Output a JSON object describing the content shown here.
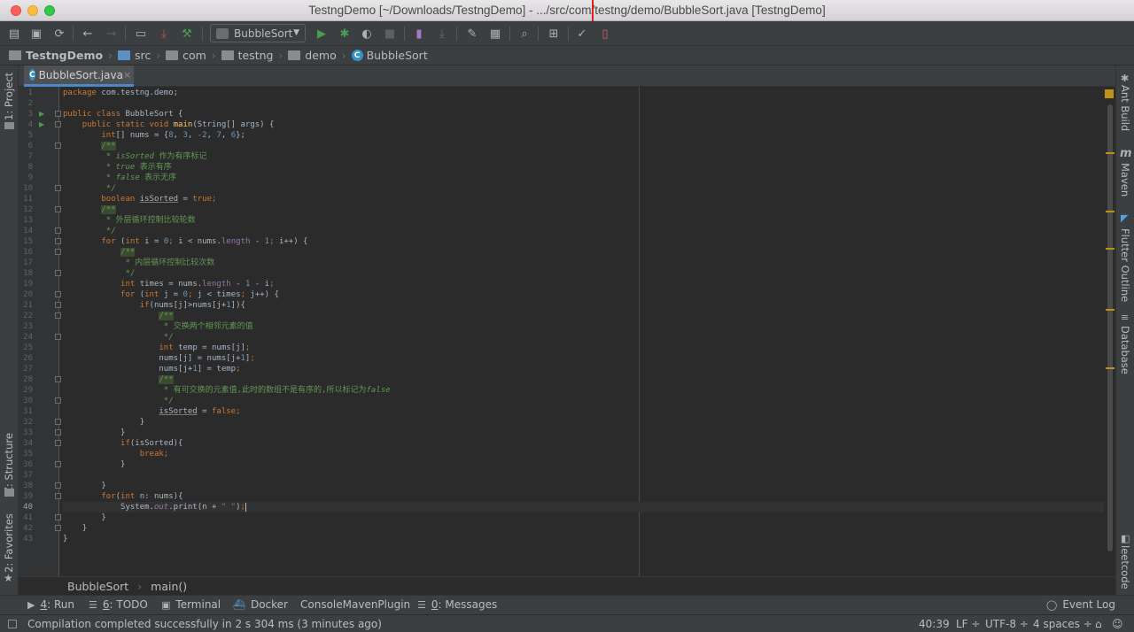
{
  "window": {
    "title": "TestngDemo [~/Downloads/TestngDemo] - .../src/com/testng/demo/BubbleSort.java [TestngDemo]"
  },
  "toolbar": {
    "run_config": "BubbleSort",
    "icons": [
      "open-icon",
      "save-icon",
      "sync-icon",
      "back-icon",
      "forward-icon",
      "terminal-icon",
      "download-icon",
      "build-icon",
      "run-icon",
      "debug-icon",
      "coverage-icon",
      "stop-icon",
      "app-icon",
      "deploy-icon",
      "wrench-icon",
      "structure-icon",
      "search-icon",
      "translate-icon",
      "vcs-icon",
      "device-icon"
    ]
  },
  "breadcrumb": {
    "project": "TestngDemo",
    "items": [
      "src",
      "com",
      "testng",
      "demo",
      "BubbleSort"
    ]
  },
  "editor": {
    "tab_label": "BubbleSort.java",
    "current_line": 40,
    "lines": [
      [
        [
          "kw",
          "package "
        ],
        [
          "",
          "com.testng.demo;"
        ]
      ],
      [],
      [
        [
          "kw",
          "public class "
        ],
        [
          "",
          "BubbleSort {"
        ]
      ],
      [
        [
          "",
          "    "
        ],
        [
          "kw",
          "public static void "
        ],
        [
          "fn",
          "main"
        ],
        [
          "",
          "(String[] args) {"
        ]
      ],
      [
        [
          "",
          "        "
        ],
        [
          "kw",
          "int"
        ],
        [
          "",
          "[] nums = {"
        ],
        [
          "num",
          "8"
        ],
        [
          "",
          ", "
        ],
        [
          "num",
          "3"
        ],
        [
          "",
          ", "
        ],
        [
          "num",
          "-2"
        ],
        [
          "",
          ", "
        ],
        [
          "num",
          "7"
        ],
        [
          "",
          ", "
        ],
        [
          "num",
          "6"
        ],
        [
          "",
          "};"
        ]
      ],
      [
        [
          "",
          "        "
        ],
        [
          "docb",
          "/**"
        ]
      ],
      [
        [
          "",
          "         "
        ],
        [
          "doc",
          "* "
        ],
        [
          "doci",
          "isSorted "
        ],
        [
          "doc",
          "作为有序标记"
        ]
      ],
      [
        [
          "",
          "         "
        ],
        [
          "doc",
          "* "
        ],
        [
          "doci",
          "true "
        ],
        [
          "doc",
          "表示有序"
        ]
      ],
      [
        [
          "",
          "         "
        ],
        [
          "doc",
          "* "
        ],
        [
          "doci",
          "false "
        ],
        [
          "doc",
          "表示无序"
        ]
      ],
      [
        [
          "",
          "         "
        ],
        [
          "doc",
          "*/"
        ]
      ],
      [
        [
          "",
          "        "
        ],
        [
          "kw",
          "boolean "
        ],
        [
          "ul",
          "isSorted"
        ],
        [
          "",
          " = "
        ],
        [
          "kw",
          "true"
        ],
        [
          "kw",
          ";"
        ]
      ],
      [
        [
          "",
          "        "
        ],
        [
          "docb",
          "/**"
        ]
      ],
      [
        [
          "",
          "         "
        ],
        [
          "doc",
          "* 外层循环控制比较轮数"
        ]
      ],
      [
        [
          "",
          "         "
        ],
        [
          "doc",
          "*/"
        ]
      ],
      [
        [
          "",
          "        "
        ],
        [
          "kw",
          "for "
        ],
        [
          "",
          "("
        ],
        [
          "kw",
          "int "
        ],
        [
          "",
          "i = "
        ],
        [
          "num",
          "0"
        ],
        [
          "kw",
          "; "
        ],
        [
          "",
          "i < nums."
        ],
        [
          "fld",
          "length "
        ],
        [
          "",
          "- "
        ],
        [
          "num",
          "1"
        ],
        [
          "kw",
          "; "
        ],
        [
          "",
          "i++) {"
        ]
      ],
      [
        [
          "",
          "            "
        ],
        [
          "docb",
          "/**"
        ]
      ],
      [
        [
          "",
          "             "
        ],
        [
          "doc",
          "* 内层循环控制比较次数"
        ]
      ],
      [
        [
          "",
          "             "
        ],
        [
          "doc",
          "*/"
        ]
      ],
      [
        [
          "",
          "            "
        ],
        [
          "kw",
          "int "
        ],
        [
          "",
          "times = nums."
        ],
        [
          "fld",
          "length "
        ],
        [
          "",
          "- "
        ],
        [
          "num",
          "1 "
        ],
        [
          "",
          "- i"
        ],
        [
          "kw",
          ";"
        ]
      ],
      [
        [
          "",
          "            "
        ],
        [
          "kw",
          "for "
        ],
        [
          "",
          "("
        ],
        [
          "kw",
          "int "
        ],
        [
          "",
          "j = "
        ],
        [
          "num",
          "0"
        ],
        [
          "kw",
          "; "
        ],
        [
          "",
          "j < times"
        ],
        [
          "kw",
          "; "
        ],
        [
          "",
          "j++) {"
        ]
      ],
      [
        [
          "",
          "                "
        ],
        [
          "kw",
          "if"
        ],
        [
          "",
          "(nums[j]>nums[j+"
        ],
        [
          "num",
          "1"
        ],
        [
          "",
          "]){"
        ]
      ],
      [
        [
          "",
          "                    "
        ],
        [
          "docb",
          "/**"
        ]
      ],
      [
        [
          "",
          "                     "
        ],
        [
          "doc",
          "* 交换两个相邻元素的值"
        ]
      ],
      [
        [
          "",
          "                     "
        ],
        [
          "doc",
          "*/"
        ]
      ],
      [
        [
          "",
          "                    "
        ],
        [
          "kw",
          "int "
        ],
        [
          "",
          "temp = nums[j]"
        ],
        [
          "kw",
          ";"
        ]
      ],
      [
        [
          "",
          "                    "
        ],
        [
          "",
          "nums[j] = nums[j+"
        ],
        [
          "num",
          "1"
        ],
        [
          "",
          "]"
        ],
        [
          "kw",
          ";"
        ]
      ],
      [
        [
          "",
          "                    "
        ],
        [
          "",
          "nums[j+"
        ],
        [
          "num",
          "1"
        ],
        [
          "",
          "] = temp"
        ],
        [
          "kw",
          ";"
        ]
      ],
      [
        [
          "",
          "                    "
        ],
        [
          "docb",
          "/**"
        ]
      ],
      [
        [
          "",
          "                     "
        ],
        [
          "doc",
          "* 有可交换的元素值,此时的数组不是有序的,所以标记为"
        ],
        [
          "doci",
          "false"
        ]
      ],
      [
        [
          "",
          "                     "
        ],
        [
          "doc",
          "*/"
        ]
      ],
      [
        [
          "",
          "                    "
        ],
        [
          "ul",
          "isSorted"
        ],
        [
          "",
          " = "
        ],
        [
          "kw",
          "false"
        ],
        [
          "kw",
          ";"
        ]
      ],
      [
        [
          "",
          "                "
        ],
        [
          "",
          "}"
        ]
      ],
      [
        [
          "",
          "            "
        ],
        [
          "",
          "}"
        ]
      ],
      [
        [
          "",
          "            "
        ],
        [
          "kw",
          "if"
        ],
        [
          "",
          "(isSorted){"
        ]
      ],
      [
        [
          "",
          "                "
        ],
        [
          "kw",
          "break"
        ],
        [
          "kw",
          ";"
        ]
      ],
      [
        [
          "",
          "            "
        ],
        [
          "",
          "}"
        ]
      ],
      [],
      [
        [
          "",
          "        "
        ],
        [
          "",
          "}"
        ]
      ],
      [
        [
          "",
          "        "
        ],
        [
          "kw",
          "for"
        ],
        [
          "",
          "("
        ],
        [
          "kw",
          "int "
        ],
        [
          "",
          "n: nums){"
        ]
      ],
      [
        [
          "",
          "            "
        ],
        [
          "",
          "System."
        ],
        [
          "fldi",
          "out"
        ],
        [
          "",
          ".print(n + "
        ],
        [
          "str",
          "\" \""
        ],
        [
          "",
          ")"
        ],
        [
          "kw",
          ";"
        ]
      ],
      [
        [
          "",
          "        "
        ],
        [
          "",
          "}"
        ]
      ],
      [
        [
          "",
          "    "
        ],
        [
          "",
          "}"
        ]
      ],
      [
        [
          "",
          "}"
        ]
      ]
    ]
  },
  "left_tabs": [
    "1: Project",
    "Z: Structure",
    "2: Favorites"
  ],
  "right_tabs": [
    "Ant Build",
    "Maven",
    "Flutter Outline",
    "Database",
    "leetcode"
  ],
  "method_crumbs": [
    "BubbleSort",
    "main()"
  ],
  "tool_windows": [
    {
      "num": "4",
      "label": "Run",
      "icon": "run-icon"
    },
    {
      "num": "6",
      "label": "TODO",
      "icon": "todo-icon"
    },
    {
      "num": "",
      "label": "Terminal",
      "icon": "terminal-icon"
    },
    {
      "num": "",
      "label": "Docker",
      "icon": "docker-icon"
    },
    {
      "num": "",
      "label": "ConsoleMavenPlugin",
      "icon": ""
    },
    {
      "num": "0",
      "label": "Messages",
      "icon": "messages-icon"
    }
  ],
  "event_log": "Event Log",
  "status": {
    "message": "Compilation completed successfully in 2 s 304 ms (3 minutes ago)",
    "position": "40:39",
    "line_sep": "LF ÷",
    "encoding": "UTF-8 ÷",
    "indent": "4 spaces ÷"
  },
  "colors": {
    "keyword": "#cc7832",
    "number": "#6897bb",
    "string": "#6a8759",
    "doc": "#629755",
    "field": "#9876aa",
    "method": "#ffc66d",
    "default": "#a9b7c6",
    "accent": "#4a88c7"
  }
}
